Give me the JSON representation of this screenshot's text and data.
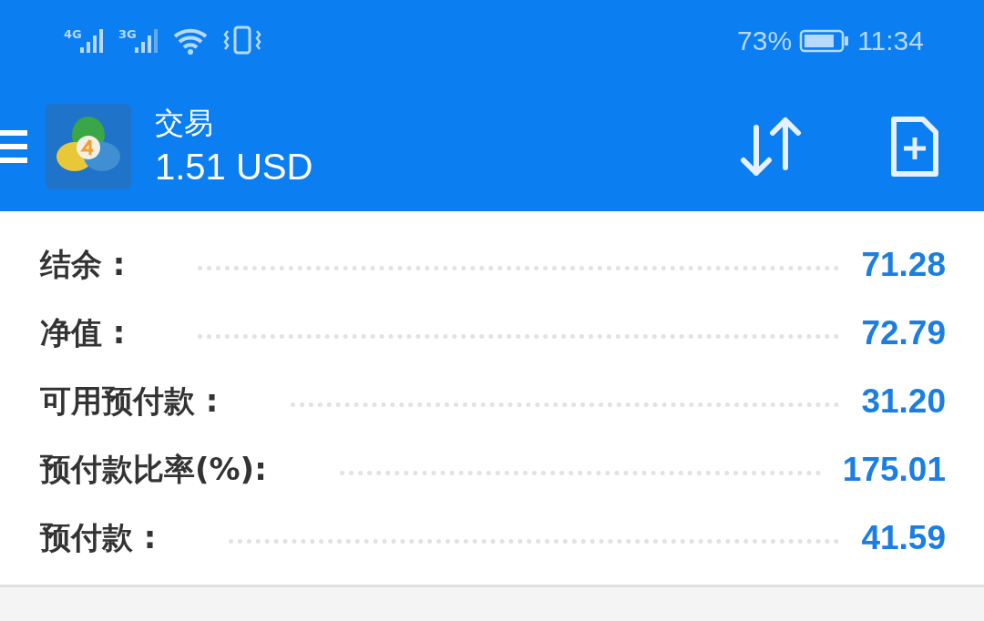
{
  "status_bar": {
    "networks": [
      "4G",
      "3G"
    ],
    "battery": "73%",
    "time": "11:34"
  },
  "toolbar": {
    "title": "交易",
    "balance": "1.51 USD"
  },
  "account": [
    {
      "label": "结余 :",
      "value": "71.28"
    },
    {
      "label": "净值 :",
      "value": "72.79"
    },
    {
      "label": "可用预付款 :",
      "value": "31.20"
    },
    {
      "label": "预付款比率(%):",
      "value": "175.01"
    },
    {
      "label": "预付款 :",
      "value": "41.59"
    }
  ]
}
